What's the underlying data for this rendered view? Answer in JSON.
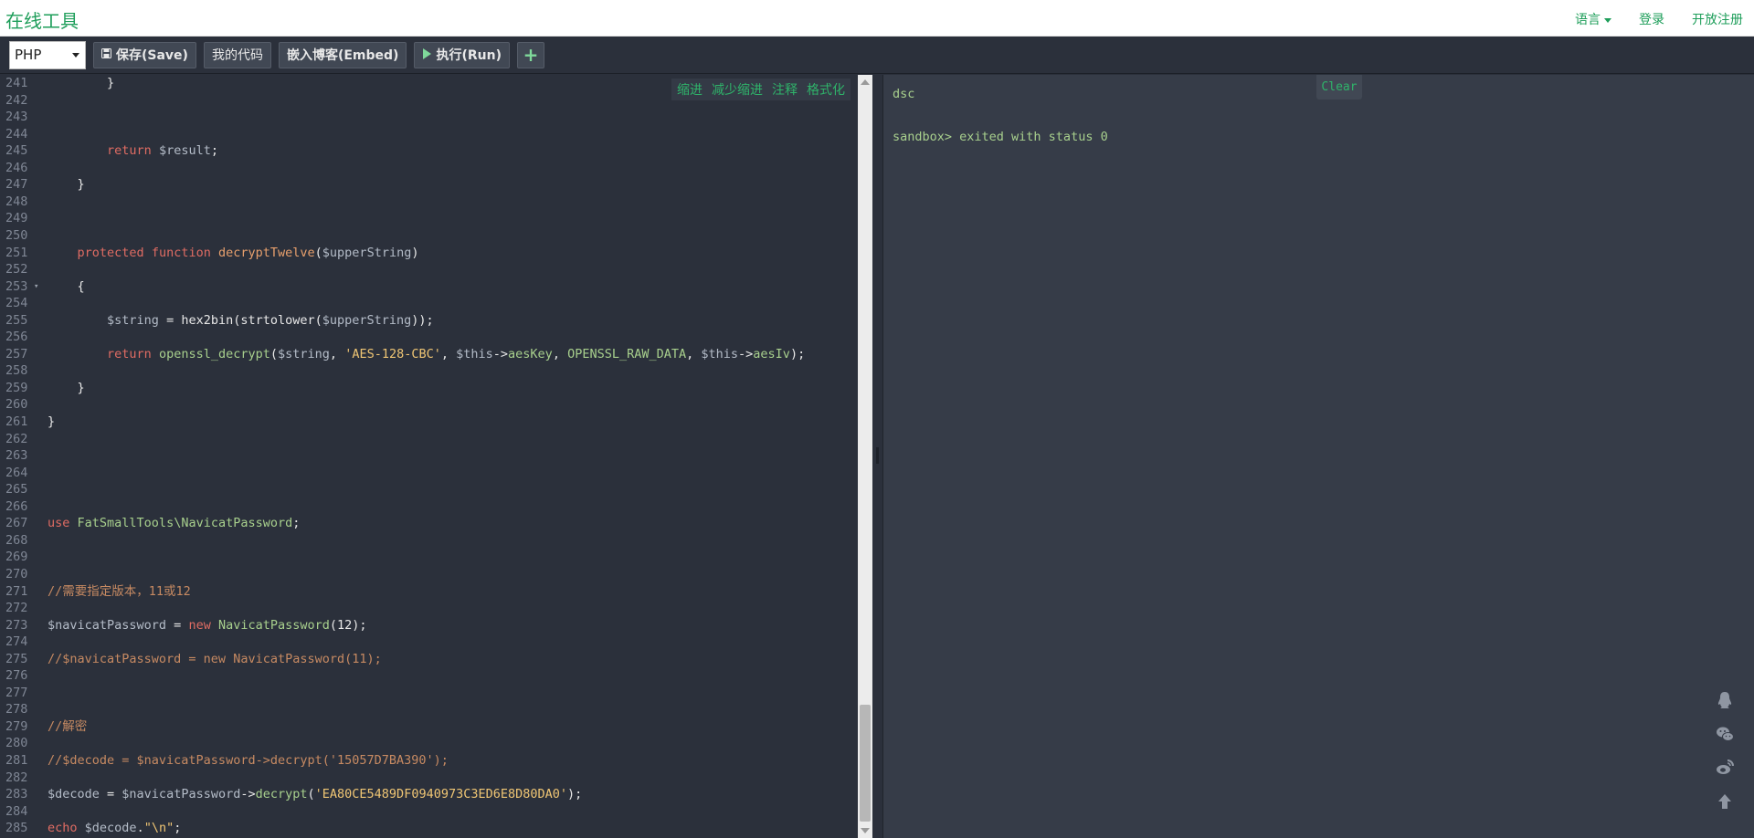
{
  "brand": "在线工具",
  "nav": {
    "language": "语言",
    "login": "登录",
    "register": "开放注册"
  },
  "toolbar": {
    "language_value": "PHP",
    "save": "保存(Save)",
    "my_code": "我的代码",
    "embed": "嵌入博客(Embed)",
    "run": "执行(Run)",
    "add": "+"
  },
  "editor_actions": [
    "缩进",
    "减少缩进",
    "注释",
    "格式化"
  ],
  "code_lines": [
    {
      "n": "241",
      "tokens": [
        [
          "p",
          "        }"
        ]
      ]
    },
    {
      "n": "242",
      "tokens": []
    },
    {
      "n": "243",
      "tokens": []
    },
    {
      "n": "244",
      "tokens": []
    },
    {
      "n": "245",
      "tokens": [
        [
          "p",
          "        "
        ],
        [
          "kw",
          "return"
        ],
        [
          "p",
          " "
        ],
        [
          "var",
          "$result"
        ],
        [
          "p",
          ";"
        ]
      ]
    },
    {
      "n": "246",
      "tokens": []
    },
    {
      "n": "247",
      "tokens": [
        [
          "p",
          "    }"
        ]
      ]
    },
    {
      "n": "248",
      "tokens": []
    },
    {
      "n": "249",
      "tokens": []
    },
    {
      "n": "250",
      "tokens": []
    },
    {
      "n": "251",
      "tokens": [
        [
          "p",
          "    "
        ],
        [
          "kw",
          "protected"
        ],
        [
          "p",
          " "
        ],
        [
          "kw",
          "function"
        ],
        [
          "p",
          " "
        ],
        [
          "fn",
          "decryptTwelve"
        ],
        [
          "p",
          "("
        ],
        [
          "var",
          "$upperString"
        ],
        [
          "p",
          ")"
        ]
      ]
    },
    {
      "n": "252",
      "tokens": []
    },
    {
      "n": "253",
      "tokens": [
        [
          "p",
          "    {"
        ]
      ],
      "fold": true
    },
    {
      "n": "254",
      "tokens": []
    },
    {
      "n": "255",
      "tokens": [
        [
          "p",
          "        "
        ],
        [
          "var",
          "$string"
        ],
        [
          "p",
          " = hex2bin(strtolower("
        ],
        [
          "var",
          "$upperString"
        ],
        [
          "p",
          "));"
        ]
      ]
    },
    {
      "n": "256",
      "tokens": []
    },
    {
      "n": "257",
      "tokens": [
        [
          "p",
          "        "
        ],
        [
          "kw",
          "return"
        ],
        [
          "p",
          " "
        ],
        [
          "cls",
          "openssl_decrypt"
        ],
        [
          "p",
          "("
        ],
        [
          "var",
          "$string"
        ],
        [
          "p",
          ", "
        ],
        [
          "str",
          "'AES-128-CBC'"
        ],
        [
          "p",
          ", "
        ],
        [
          "var",
          "$this"
        ],
        [
          "p",
          "->"
        ],
        [
          "cls",
          "aesKey"
        ],
        [
          "p",
          ", "
        ],
        [
          "const",
          "OPENSSL_RAW_DATA"
        ],
        [
          "p",
          ", "
        ],
        [
          "var",
          "$this"
        ],
        [
          "p",
          "->"
        ],
        [
          "cls",
          "aesIv"
        ],
        [
          "p",
          ");"
        ]
      ]
    },
    {
      "n": "258",
      "tokens": []
    },
    {
      "n": "259",
      "tokens": [
        [
          "p",
          "    }"
        ]
      ]
    },
    {
      "n": "260",
      "tokens": []
    },
    {
      "n": "261",
      "tokens": [
        [
          "p",
          "}"
        ]
      ]
    },
    {
      "n": "262",
      "tokens": []
    },
    {
      "n": "263",
      "tokens": []
    },
    {
      "n": "264",
      "tokens": []
    },
    {
      "n": "265",
      "tokens": []
    },
    {
      "n": "266",
      "tokens": []
    },
    {
      "n": "267",
      "tokens": [
        [
          "kw",
          "use"
        ],
        [
          "p",
          " "
        ],
        [
          "cls",
          "FatSmallTools\\NavicatPassword"
        ],
        [
          "p",
          ";"
        ]
      ]
    },
    {
      "n": "268",
      "tokens": []
    },
    {
      "n": "269",
      "tokens": []
    },
    {
      "n": "270",
      "tokens": []
    },
    {
      "n": "271",
      "tokens": [
        [
          "com",
          "//需要指定版本，11或12"
        ]
      ]
    },
    {
      "n": "272",
      "tokens": []
    },
    {
      "n": "273",
      "tokens": [
        [
          "var",
          "$navicatPassword"
        ],
        [
          "p",
          " = "
        ],
        [
          "kw",
          "new"
        ],
        [
          "p",
          " "
        ],
        [
          "cls",
          "NavicatPassword"
        ],
        [
          "p",
          "(12);"
        ]
      ]
    },
    {
      "n": "274",
      "tokens": []
    },
    {
      "n": "275",
      "tokens": [
        [
          "com",
          "//$navicatPassword = new NavicatPassword(11);"
        ]
      ]
    },
    {
      "n": "276",
      "tokens": []
    },
    {
      "n": "277",
      "tokens": []
    },
    {
      "n": "278",
      "tokens": []
    },
    {
      "n": "279",
      "tokens": [
        [
          "com",
          "//解密"
        ]
      ]
    },
    {
      "n": "280",
      "tokens": []
    },
    {
      "n": "281",
      "tokens": [
        [
          "com",
          "//$decode = $navicatPassword->decrypt('15057D7BA390');"
        ]
      ]
    },
    {
      "n": "282",
      "tokens": []
    },
    {
      "n": "283",
      "tokens": [
        [
          "var",
          "$decode"
        ],
        [
          "p",
          " = "
        ],
        [
          "var",
          "$navicatPassword"
        ],
        [
          "p",
          "->"
        ],
        [
          "cls",
          "decrypt"
        ],
        [
          "p",
          "("
        ],
        [
          "str",
          "'EA80CE5489DF0940973C3ED6E8D80DA0'"
        ],
        [
          "p",
          ");"
        ]
      ]
    },
    {
      "n": "284",
      "tokens": []
    },
    {
      "n": "285",
      "tokens": [
        [
          "kw",
          "echo"
        ],
        [
          "p",
          " "
        ],
        [
          "var",
          "$decode"
        ],
        [
          "p",
          "."
        ],
        [
          "str",
          "\"\\n\""
        ],
        [
          "p",
          ";"
        ]
      ]
    }
  ],
  "output": {
    "clear": "Clear",
    "lines": [
      "dsc",
      "",
      "sandbox> exited with status 0"
    ]
  },
  "colors": {
    "accent": "#1e9e5a",
    "editor_bg": "#2b303b",
    "output_bg": "#363c48"
  },
  "social_icons": [
    "qq-icon",
    "wechat-icon",
    "weibo-icon",
    "back-to-top-icon"
  ]
}
